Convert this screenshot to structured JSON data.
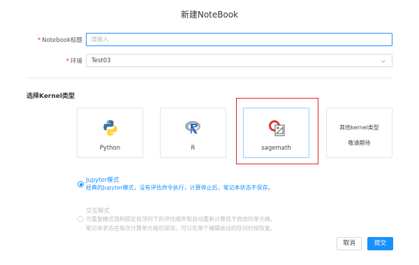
{
  "dialog": {
    "title": "新建NoteBook"
  },
  "form": {
    "notebook_title": {
      "label": "Notebook标题",
      "placeholder": "请输入",
      "value": ""
    },
    "environment": {
      "label": "环境",
      "value": "Test03"
    }
  },
  "kernel": {
    "section_title": "选择Kernel类型",
    "cards": [
      {
        "label": "Python",
        "icon": "python-logo-icon"
      },
      {
        "label": "R",
        "icon": "r-logo-icon"
      },
      {
        "label": "sagemath",
        "icon": "sagemath-logo-icon",
        "selected": true
      },
      {
        "label_line1": "其他kernel类型",
        "label_line2": "敬请期待"
      }
    ]
  },
  "modes": {
    "jupyter": {
      "title": "Jupyter模式",
      "desc": "经典的Jupyter模式，没有评估命令执行，计算停止后，笔记本状态不保存。",
      "checked": true
    },
    "interactive": {
      "title": "交互模式",
      "desc_line1": "可重复模式强制固定自顶向下的评估顺序和自动重新计算低于修改的单元格。",
      "desc_line2": "笔记本状态在每次计算单元格后保存。可以在单个编辑会话的任何时候恢复。",
      "checked": false
    }
  },
  "buttons": {
    "cancel": "取消",
    "submit": "提交"
  },
  "colors": {
    "primary": "#1890ff",
    "highlight": "#e02020",
    "required": "#f5222d"
  }
}
